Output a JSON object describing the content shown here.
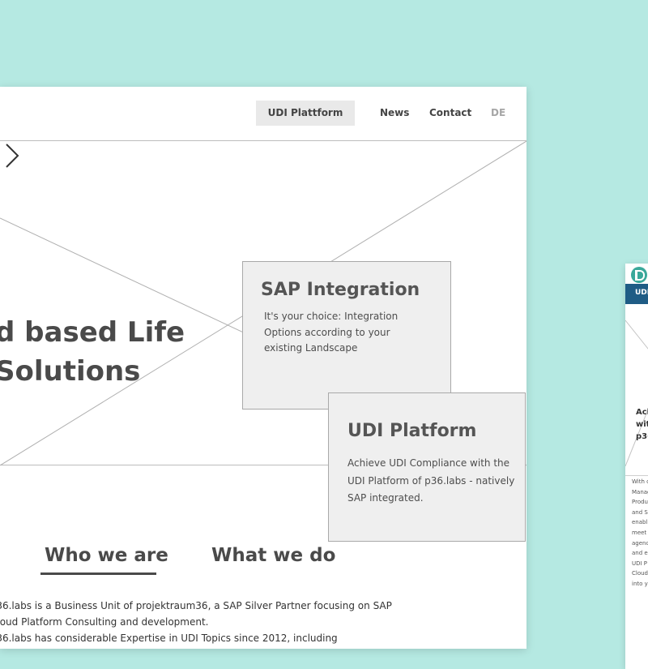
{
  "nav": {
    "udi_label": "UDI Plattform",
    "news_label": "News",
    "contact_label": "Contact",
    "lang_label": "DE"
  },
  "hero": {
    "title_line1": "d based Life",
    "title_line2": "Solutions"
  },
  "cards": {
    "sap": {
      "title": "SAP Integration",
      "text": "It's your choice: Integration Options according to your existing Landscape"
    },
    "udi": {
      "title": "UDI Platform",
      "text": "Achieve UDI Compliance with the UDI Platform of p36.labs - natively SAP integrated."
    }
  },
  "tabs": {
    "who": "Who we are",
    "what": "What we do"
  },
  "body": {
    "line1": "o36.labs is a Business Unit of projektraum36, a SAP Silver Partner focusing on SAP",
    "line2": "Cloud Platform Consulting and development.",
    "line3": "o36.labs has considerable Expertise in UDI Topics since 2012, including"
  },
  "mobile": {
    "bar_label": "UDI",
    "hero_line1": "Ach",
    "hero_line2": "wit",
    "hero_line3": "p36",
    "text_lines": [
      "With c",
      "Manag",
      "Produ",
      "and S",
      "enabl",
      "meet",
      "agenc",
      "and e",
      "UDI P",
      "Cloud",
      "into y"
    ]
  },
  "colors": {
    "background": "#b5e9e2",
    "mobile_bar": "#1f5c85",
    "logo": "#3aa89a"
  }
}
